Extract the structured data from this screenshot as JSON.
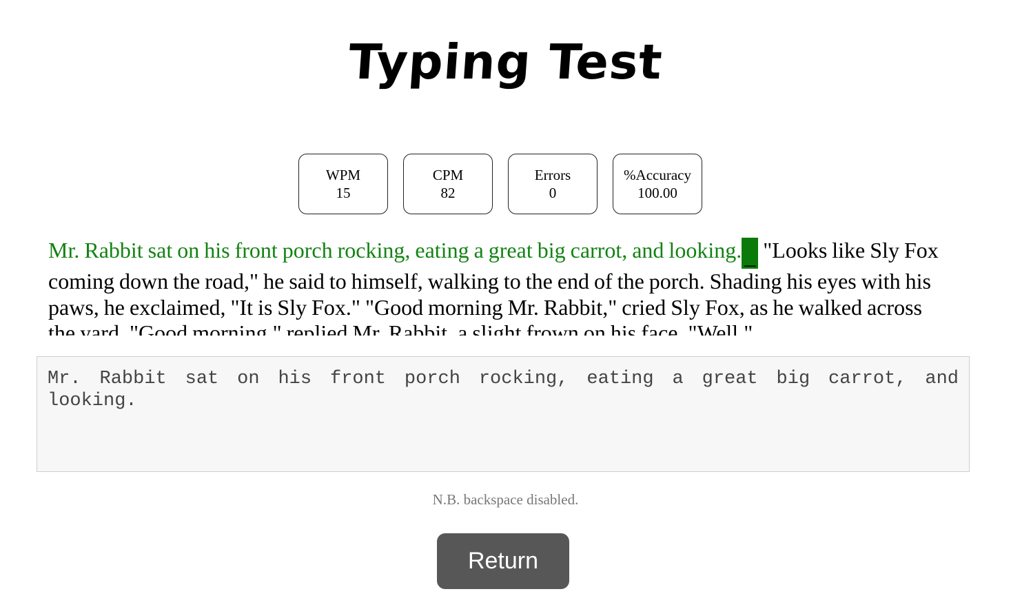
{
  "title": "Typing Test",
  "stats": [
    {
      "label": "WPM",
      "value": "15"
    },
    {
      "label": "CPM",
      "value": "82"
    },
    {
      "label": "Errors",
      "value": "0"
    },
    {
      "label": "%Accuracy",
      "value": "100.00"
    }
  ],
  "passage": {
    "typed": "Mr. Rabbit sat on his front porch rocking, eating a great big carrot, and looking.",
    "cursor": "_",
    "remaining": " \"Looks like Sly Fox coming down the road,\" he said to himself, walking to the end of the porch. Shading his eyes with his paws, he exclaimed, \"It is Sly Fox.\" \"Good morning Mr. Rabbit,\" cried Sly Fox, as he walked across the yard. \"Good morning,\" replied Mr. Rabbit, a slight frown on his face. \"Well,\""
  },
  "input": {
    "value": "Mr. Rabbit sat on his front porch rocking, eating a great big carrot, and looking."
  },
  "note": "N.B. backspace disabled.",
  "return_label": "Return",
  "colors": {
    "typed_text": "#128312",
    "cursor_bg": "#0a7a0a",
    "button_bg": "#575757"
  }
}
